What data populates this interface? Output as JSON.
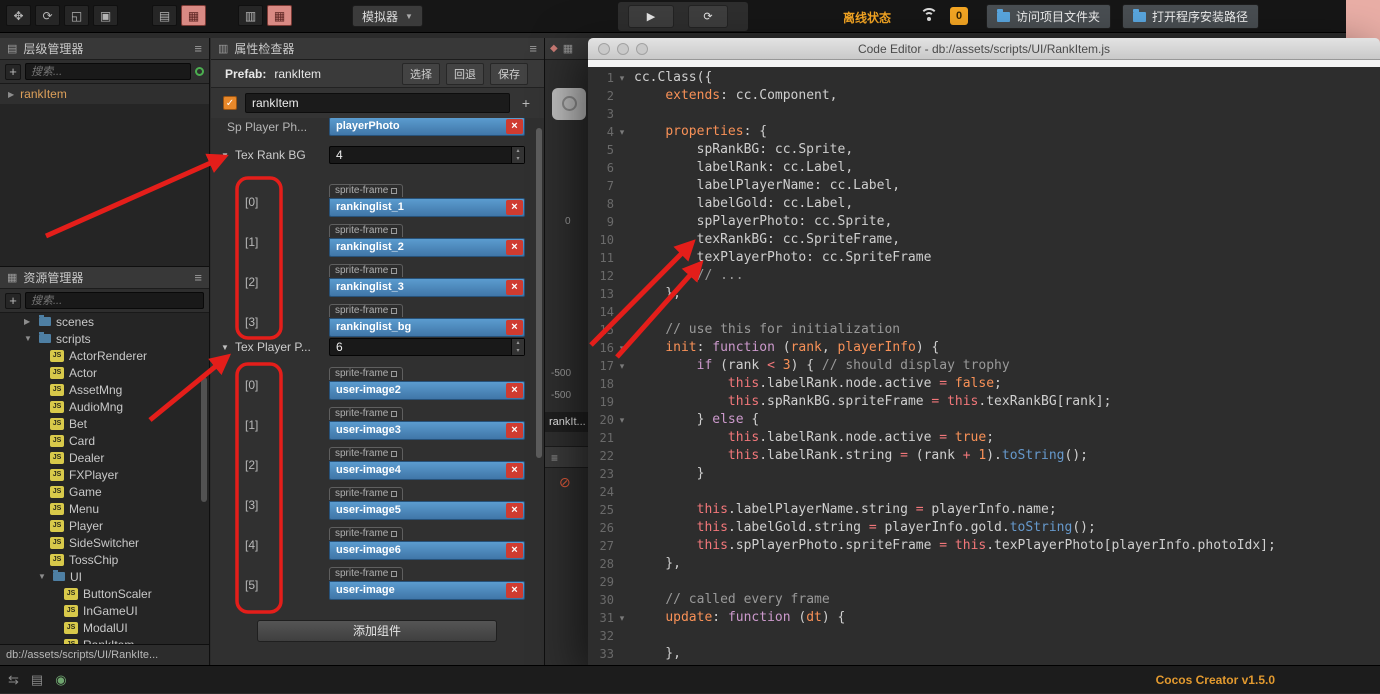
{
  "glyphs": {
    "close": "×",
    "play": "▶",
    "refresh": "⟳",
    "caret_down": "▼",
    "tri_right": "▶",
    "tri_down": "▼",
    "hamburger": "≡",
    "check": "✓",
    "plus": "+",
    "fold": "▾",
    "step_up": "▴",
    "step_down": "▾",
    "prohibit": "⊘",
    "sync": "⇆",
    "list": "▤",
    "eye": "◉",
    "panel_icon_a": "▤",
    "panel_icon_b": "▦",
    "panel_icon_c": "▥",
    "scene_diamond": "◆",
    "scene_grid": "▦"
  },
  "colors": {
    "accent_orange": "#f5a623",
    "annotation_red": "#e41e1a",
    "ref_field_blue": "#4a8bc2",
    "version_orange": "#e39a2f"
  },
  "toolbar": {
    "tools": [
      {
        "name": "move-tool",
        "glyph": "✥"
      },
      {
        "name": "rotate-tool",
        "glyph": "⟳"
      },
      {
        "name": "scale-tool",
        "glyph": "◱"
      },
      {
        "name": "rect-tool",
        "glyph": "▣"
      }
    ],
    "layout_groups": [
      [
        {
          "name": "layout-toggle-a",
          "glyph": "▤",
          "active": false
        },
        {
          "name": "layout-toggle-b",
          "glyph": "▦",
          "active": true
        }
      ],
      [
        {
          "name": "layout-toggle-c",
          "glyph": "▥",
          "active": false
        },
        {
          "name": "layout-toggle-d",
          "glyph": "▦",
          "active": true
        }
      ]
    ],
    "simulator_label": "模拟器",
    "offline_status": "离线状态",
    "notification_count": "0",
    "open_project_folder": "访问项目文件夹",
    "open_install_path": "打开程序安装路径"
  },
  "hierarchy": {
    "title": "层级管理器",
    "search_placeholder": "搜索...",
    "nodes": [
      {
        "name": "rankItem",
        "arrow": "▶"
      }
    ]
  },
  "assets": {
    "title": "资源管理器",
    "search_placeholder": "搜索...",
    "js_badge": "JS",
    "items": [
      {
        "depth": 1,
        "kind": "folder",
        "arrow": "▶",
        "name": "scenes"
      },
      {
        "depth": 1,
        "kind": "folder",
        "arrow": "▼",
        "name": "scripts"
      },
      {
        "depth": 2,
        "kind": "js",
        "name": "ActorRenderer"
      },
      {
        "depth": 2,
        "kind": "js",
        "name": "Actor"
      },
      {
        "depth": 2,
        "kind": "js",
        "name": "AssetMng"
      },
      {
        "depth": 2,
        "kind": "js",
        "name": "AudioMng"
      },
      {
        "depth": 2,
        "kind": "js",
        "name": "Bet"
      },
      {
        "depth": 2,
        "kind": "js",
        "name": "Card"
      },
      {
        "depth": 2,
        "kind": "js",
        "name": "Dealer"
      },
      {
        "depth": 2,
        "kind": "js",
        "name": "FXPlayer"
      },
      {
        "depth": 2,
        "kind": "js",
        "name": "Game"
      },
      {
        "depth": 2,
        "kind": "js",
        "name": "Menu"
      },
      {
        "depth": 2,
        "kind": "js",
        "name": "Player"
      },
      {
        "depth": 2,
        "kind": "js",
        "name": "SideSwitcher"
      },
      {
        "depth": 2,
        "kind": "js",
        "name": "TossChip"
      },
      {
        "depth": 2,
        "kind": "folder",
        "arrow": "▼",
        "name": "UI"
      },
      {
        "depth": 3,
        "kind": "js",
        "name": "ButtonScaler"
      },
      {
        "depth": 3,
        "kind": "js",
        "name": "InGameUI"
      },
      {
        "depth": 3,
        "kind": "js",
        "name": "ModalUI"
      },
      {
        "depth": 3,
        "kind": "js",
        "name": "RankItem"
      }
    ]
  },
  "status_path": "db://assets/scripts/UI/RankIte...",
  "inspector": {
    "title": "属性检查器",
    "prefab_label": "Prefab:",
    "prefab_name": "rankItem",
    "actions": [
      {
        "label": "选择"
      },
      {
        "label": "回退"
      },
      {
        "label": "保存"
      }
    ],
    "node_name": "rankItem",
    "partial_row": {
      "label": "Sp Player Ph...",
      "type": "sprite-frame",
      "value": "playerPhoto"
    },
    "groups": [
      {
        "label": "Tex Rank BG",
        "count": "4",
        "items": [
          {
            "index": "[0]",
            "type": "sprite-frame",
            "value": "rankinglist_1"
          },
          {
            "index": "[1]",
            "type": "sprite-frame",
            "value": "rankinglist_2"
          },
          {
            "index": "[2]",
            "type": "sprite-frame",
            "value": "rankinglist_3"
          },
          {
            "index": "[3]",
            "type": "sprite-frame",
            "value": "rankinglist_bg"
          }
        ]
      },
      {
        "label": "Tex Player P...",
        "count": "6",
        "items": [
          {
            "index": "[0]",
            "type": "sprite-frame",
            "value": "user-image2"
          },
          {
            "index": "[1]",
            "type": "sprite-frame",
            "value": "user-image3"
          },
          {
            "index": "[2]",
            "type": "sprite-frame",
            "value": "user-image4"
          },
          {
            "index": "[3]",
            "type": "sprite-frame",
            "value": "user-image5"
          },
          {
            "index": "[4]",
            "type": "sprite-frame",
            "value": "user-image6"
          },
          {
            "index": "[5]",
            "type": "sprite-frame",
            "value": "user-image"
          }
        ]
      }
    ],
    "add_component_label": "添加组件"
  },
  "scene_strip": {
    "origin_label": "0",
    "ruler_label_1": "-500",
    "ruler_label_2": "-500",
    "node_label": "rankIt..."
  },
  "code_editor": {
    "title": "Code Editor - db://assets/scripts/UI/RankItem.js",
    "fold_lines": [
      1,
      4,
      16,
      17,
      20,
      31
    ],
    "lines": [
      [
        [
          "p",
          "cc.Class({"
        ]
      ],
      [
        [
          "p",
          "    "
        ],
        [
          "o",
          "extends"
        ],
        [
          "p",
          ": cc.Component,"
        ]
      ],
      [],
      [
        [
          "p",
          "    "
        ],
        [
          "o",
          "properties"
        ],
        [
          "p",
          ": {"
        ]
      ],
      [
        [
          "p",
          "        spRankBG: cc.Sprite,"
        ]
      ],
      [
        [
          "p",
          "        labelRank: cc.Label,"
        ]
      ],
      [
        [
          "p",
          "        labelPlayerName: cc.Label,"
        ]
      ],
      [
        [
          "p",
          "        labelGold: cc.Label,"
        ]
      ],
      [
        [
          "p",
          "        spPlayerPhoto: cc.Sprite,"
        ]
      ],
      [
        [
          "p",
          "        texRankBG: cc.SpriteFrame,"
        ]
      ],
      [
        [
          "p",
          "        texPlayerPhoto: cc.SpriteFrame"
        ]
      ],
      [
        [
          "p",
          "        "
        ],
        [
          "c",
          "// ..."
        ]
      ],
      [
        [
          "p",
          "    },"
        ]
      ],
      [],
      [
        [
          "p",
          "    "
        ],
        [
          "c",
          "// use this for initialization"
        ]
      ],
      [
        [
          "p",
          "    "
        ],
        [
          "o",
          "init"
        ],
        [
          "p",
          ": "
        ],
        [
          "k",
          "function"
        ],
        [
          "p",
          " ("
        ],
        [
          "o",
          "rank"
        ],
        [
          "p",
          ", "
        ],
        [
          "o",
          "playerInfo"
        ],
        [
          "p",
          ") {"
        ]
      ],
      [
        [
          "p",
          "        "
        ],
        [
          "k",
          "if"
        ],
        [
          "p",
          " (rank "
        ],
        [
          "r",
          "<"
        ],
        [
          "p",
          " "
        ],
        [
          "o",
          "3"
        ],
        [
          "p",
          ") { "
        ],
        [
          "c",
          "// should display trophy"
        ]
      ],
      [
        [
          "p",
          "            "
        ],
        [
          "r",
          "this"
        ],
        [
          "p",
          ".labelRank.node.active "
        ],
        [
          "r",
          "="
        ],
        [
          "p",
          " "
        ],
        [
          "o",
          "false"
        ],
        [
          "p",
          ";"
        ]
      ],
      [
        [
          "p",
          "            "
        ],
        [
          "r",
          "this"
        ],
        [
          "p",
          ".spRankBG.spriteFrame "
        ],
        [
          "r",
          "="
        ],
        [
          "p",
          " "
        ],
        [
          "r",
          "this"
        ],
        [
          "p",
          ".texRankBG[rank];"
        ]
      ],
      [
        [
          "p",
          "        } "
        ],
        [
          "k",
          "else"
        ],
        [
          "p",
          " {"
        ]
      ],
      [
        [
          "p",
          "            "
        ],
        [
          "r",
          "this"
        ],
        [
          "p",
          ".labelRank.node.active "
        ],
        [
          "r",
          "="
        ],
        [
          "p",
          " "
        ],
        [
          "o",
          "true"
        ],
        [
          "p",
          ";"
        ]
      ],
      [
        [
          "p",
          "            "
        ],
        [
          "r",
          "this"
        ],
        [
          "p",
          ".labelRank.string "
        ],
        [
          "r",
          "="
        ],
        [
          "p",
          " (rank "
        ],
        [
          "r",
          "+"
        ],
        [
          "p",
          " "
        ],
        [
          "o",
          "1"
        ],
        [
          "p",
          ")."
        ],
        [
          "b",
          "toString"
        ],
        [
          "p",
          "();"
        ]
      ],
      [
        [
          "p",
          "        }"
        ]
      ],
      [],
      [
        [
          "p",
          "        "
        ],
        [
          "r",
          "this"
        ],
        [
          "p",
          ".labelPlayerName.string "
        ],
        [
          "r",
          "="
        ],
        [
          "p",
          " playerInfo.name;"
        ]
      ],
      [
        [
          "p",
          "        "
        ],
        [
          "r",
          "this"
        ],
        [
          "p",
          ".labelGold.string "
        ],
        [
          "r",
          "="
        ],
        [
          "p",
          " playerInfo.gold."
        ],
        [
          "b",
          "toString"
        ],
        [
          "p",
          "();"
        ]
      ],
      [
        [
          "p",
          "        "
        ],
        [
          "r",
          "this"
        ],
        [
          "p",
          ".spPlayerPhoto.spriteFrame "
        ],
        [
          "r",
          "="
        ],
        [
          "p",
          " "
        ],
        [
          "r",
          "this"
        ],
        [
          "p",
          ".texPlayerPhoto[playerInfo.photoIdx];"
        ]
      ],
      [
        [
          "p",
          "    },"
        ]
      ],
      [],
      [
        [
          "p",
          "    "
        ],
        [
          "c",
          "// called every frame"
        ]
      ],
      [
        [
          "p",
          "    "
        ],
        [
          "o",
          "update"
        ],
        [
          "p",
          ": "
        ],
        [
          "k",
          "function"
        ],
        [
          "p",
          " ("
        ],
        [
          "o",
          "dt"
        ],
        [
          "p",
          ") {"
        ]
      ],
      [],
      [
        [
          "p",
          "    },"
        ]
      ],
      [
        [
          "p",
          "});"
        ]
      ]
    ]
  },
  "footer": {
    "version": "Cocos Creator v1.5.0"
  }
}
